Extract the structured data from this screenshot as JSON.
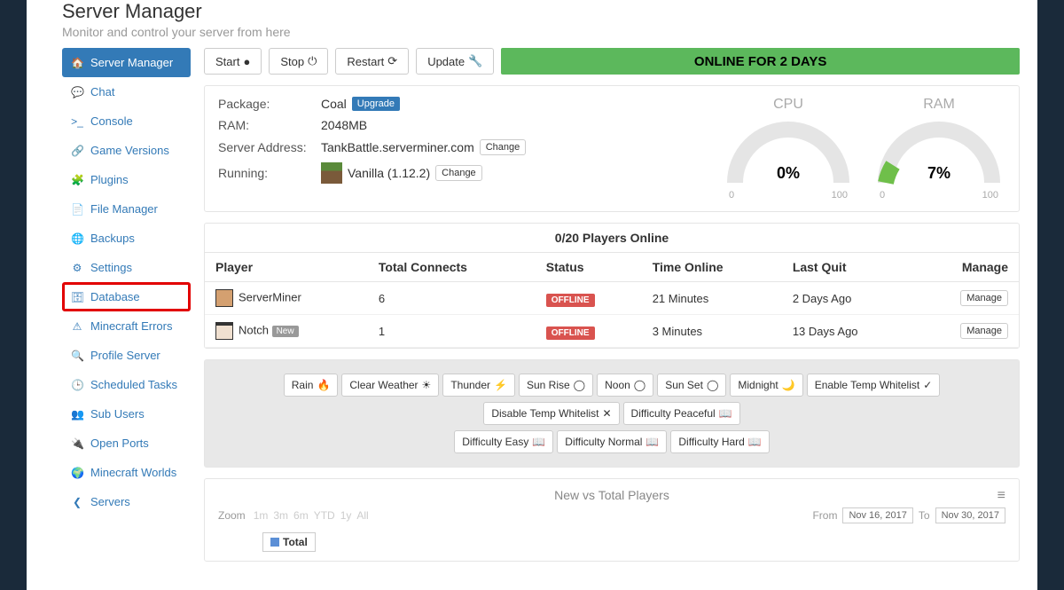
{
  "header": {
    "title": "Server Manager",
    "subtitle": "Monitor and control your server from here"
  },
  "sidebar": {
    "items": [
      {
        "icon": "🏠",
        "label": "Server Manager",
        "active": true
      },
      {
        "icon": "💬",
        "label": "Chat"
      },
      {
        "icon": ">_",
        "label": "Console"
      },
      {
        "icon": "🔗",
        "label": "Game Versions"
      },
      {
        "icon": "🧩",
        "label": "Plugins"
      },
      {
        "icon": "📄",
        "label": "File Manager"
      },
      {
        "icon": "🌐",
        "label": "Backups"
      },
      {
        "icon": "⚙",
        "label": "Settings"
      },
      {
        "icon": "🗄",
        "label": "Database",
        "highlighted": true
      },
      {
        "icon": "⚠",
        "label": "Minecraft Errors"
      },
      {
        "icon": "🔍",
        "label": "Profile Server"
      },
      {
        "icon": "🕒",
        "label": "Scheduled Tasks"
      },
      {
        "icon": "👥",
        "label": "Sub Users"
      },
      {
        "icon": "🔌",
        "label": "Open Ports"
      },
      {
        "icon": "🌍",
        "label": "Minecraft Worlds"
      },
      {
        "icon": "❮",
        "label": "Servers"
      }
    ]
  },
  "toolbar": {
    "start": "Start",
    "stop": "Stop",
    "restart": "Restart",
    "update": "Update",
    "status": "ONLINE FOR 2 DAYS"
  },
  "info": {
    "package_label": "Package:",
    "package": "Coal",
    "upgrade": "Upgrade",
    "ram_label": "RAM:",
    "ram": "2048MB",
    "address_label": "Server Address:",
    "address": "TankBattle.serverminer.com",
    "change": "Change",
    "running_label": "Running:",
    "running": "Vanilla (1.12.2)"
  },
  "gauges": {
    "cpu": {
      "title": "CPU",
      "value": "0%",
      "min": "0",
      "max": "100",
      "pct": 0
    },
    "ram": {
      "title": "RAM",
      "value": "7%",
      "min": "0",
      "max": "100",
      "pct": 7
    }
  },
  "players": {
    "header": "0/20 Players Online",
    "cols": {
      "player": "Player",
      "connects": "Total Connects",
      "status": "Status",
      "time": "Time Online",
      "last": "Last Quit",
      "manage": "Manage"
    },
    "rows": [
      {
        "name": "ServerMiner",
        "avatar": "a1",
        "connects": "6",
        "status": "OFFLINE",
        "time": "21 Minutes",
        "last": "2 Days Ago",
        "new": false
      },
      {
        "name": "Notch",
        "avatar": "a2",
        "connects": "1",
        "status": "OFFLINE",
        "time": "3 Minutes",
        "last": "13 Days Ago",
        "new": true
      }
    ],
    "new_badge": "New",
    "manage_btn": "Manage"
  },
  "commands": [
    "Rain",
    "Clear Weather",
    "Thunder",
    "Sun Rise",
    "Noon",
    "Sun Set",
    "Midnight",
    "Enable Temp Whitelist",
    "Disable Temp Whitelist",
    "Difficulty Peaceful",
    "Difficulty Easy",
    "Difficulty Normal",
    "Difficulty Hard"
  ],
  "command_icons": [
    "🔥",
    "☀",
    "⚡",
    "◯",
    "◯",
    "◯",
    "🌙",
    "✓",
    "✕",
    "📖",
    "📖",
    "📖",
    "📖"
  ],
  "chart": {
    "title": "New vs Total Players",
    "zoom_label": "Zoom",
    "zoom": [
      "1m",
      "3m",
      "6m",
      "YTD",
      "1y",
      "All"
    ],
    "from_label": "From",
    "from": "Nov 16, 2017",
    "to_label": "To",
    "to": "Nov 30, 2017",
    "legend": "Total"
  },
  "chart_data": {
    "type": "line",
    "title": "New vs Total Players",
    "x_range": [
      "2017-11-16",
      "2017-11-30"
    ],
    "series": [
      {
        "name": "Total",
        "values": []
      }
    ]
  }
}
